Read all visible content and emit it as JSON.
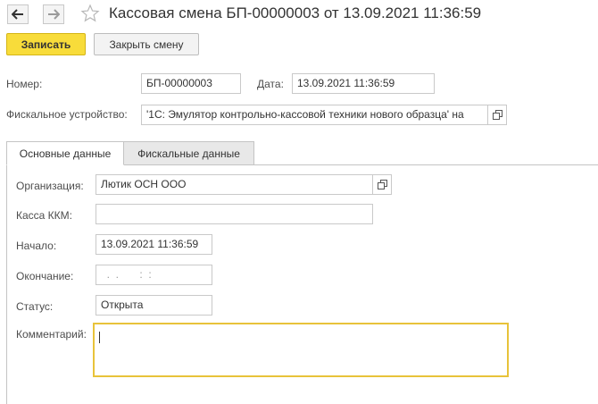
{
  "header": {
    "title": "Кассовая смена БП-00000003 от 13.09.2021 11:36:59"
  },
  "toolbar": {
    "save_label": "Записать",
    "close_shift_label": "Закрыть смену"
  },
  "form": {
    "number_label": "Номер:",
    "number_value": "БП-00000003",
    "date_label": "Дата:",
    "date_value": "13.09.2021 11:36:59",
    "device_label": "Фискальное устройство:",
    "device_value": "'1С: Эмулятор контрольно-кассовой техники нового образца' на"
  },
  "tabs": [
    {
      "label": "Основные данные",
      "active": true
    },
    {
      "label": "Фискальные данные",
      "active": false
    }
  ],
  "main": {
    "org_label": "Организация:",
    "org_value": "Лютик ОСН ООО",
    "kkm_label": "Касса ККМ:",
    "kkm_value": "",
    "start_label": "Начало:",
    "start_value": "13.09.2021 11:36:59",
    "end_label": "Окончание:",
    "end_value": "  .  .       :  :",
    "status_label": "Статус:",
    "status_value": "Открыта",
    "comment_label": "Комментарий:",
    "comment_value": ""
  },
  "colors": {
    "primary_button": "#f8dc3a",
    "focus_border": "#e8c33a"
  }
}
